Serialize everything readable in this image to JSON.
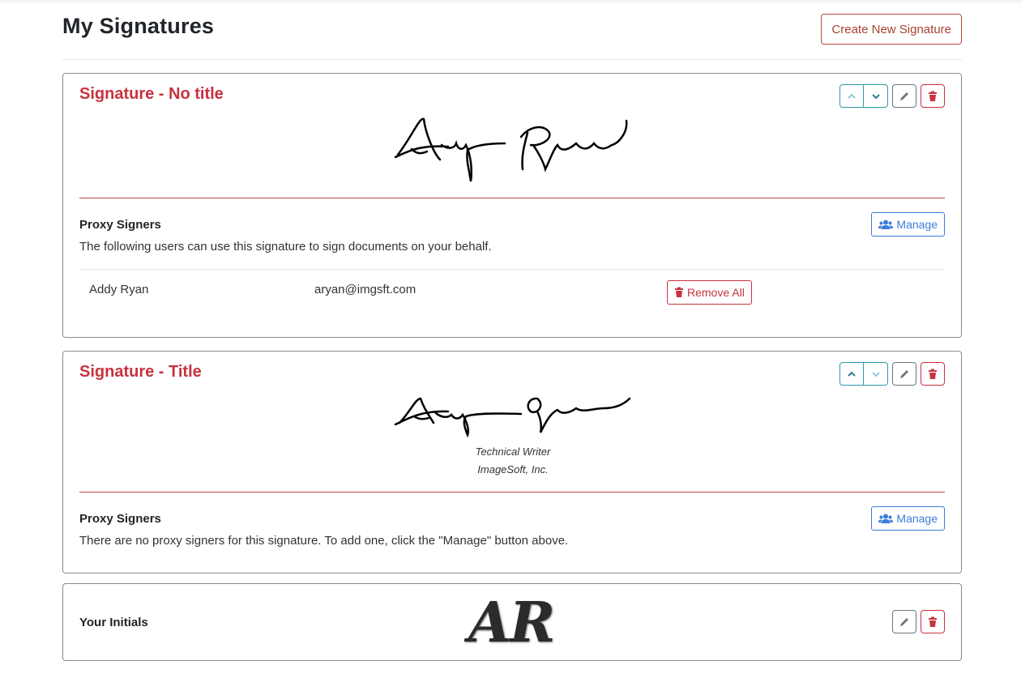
{
  "header": {
    "title": "My Signatures",
    "create_label": "Create New Signature"
  },
  "signatures": [
    {
      "title": "Signature - No title",
      "proxy_heading": "Proxy Signers",
      "proxy_description": "The following users can use this signature to sign documents on your behalf.",
      "manage_label": "Manage",
      "proxies": [
        {
          "name": "Addy Ryan",
          "email": "aryan@imgsft.com",
          "remove_label": "Remove All"
        }
      ]
    },
    {
      "title": "Signature - Title",
      "caption_line1": "Technical Writer",
      "caption_line2": "ImageSoft, Inc.",
      "proxy_heading": "Proxy Signers",
      "proxy_description": "There are no proxy signers for this signature. To add one, click the \"Manage\" button above.",
      "manage_label": "Manage"
    }
  ],
  "initials": {
    "label": "Your Initials",
    "mark": "AR"
  },
  "icons": {
    "up": "chevron-up-icon",
    "down": "chevron-down-icon",
    "edit": "pencil-icon",
    "delete": "trash-icon",
    "users": "users-icon"
  },
  "colors": {
    "title_red": "#c8323f",
    "accent_teal": "#2d9aa8",
    "manage_blue": "#3b7dd8",
    "divider": "#b44a3a"
  }
}
